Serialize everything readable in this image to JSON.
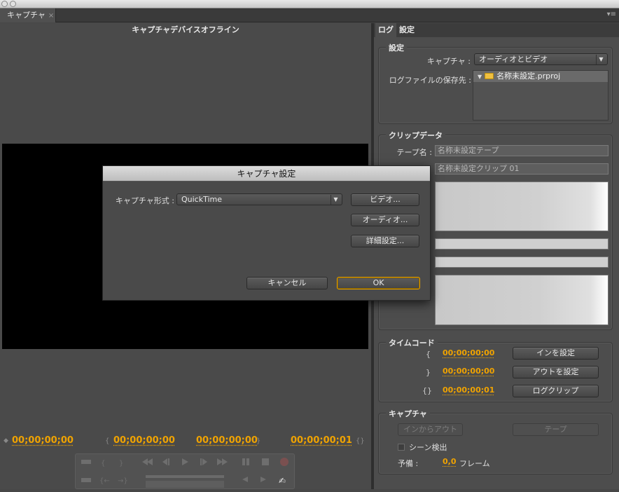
{
  "panel": {
    "tab_label": "キャプチャ",
    "close": "×",
    "menu_icon": "▾≡"
  },
  "monitor": {
    "status": "キャプチャデバイスオフライン",
    "timecodes": {
      "current": "00;00;00;00",
      "in": "00;00;00;00",
      "out": "00;00;00;00",
      "duration": "00;00;00;01"
    },
    "marks": {
      "in": "{",
      "out": "}",
      "dur": "{}"
    }
  },
  "right": {
    "tabs": [
      "ログ",
      "設定"
    ],
    "settings": {
      "title": "設定",
      "capture_label": "キャプチャ :",
      "capture_value": "オーディオとビデオ",
      "log_label": "ログファイルの保存先 :",
      "log_value": "名称未設定.prproj"
    },
    "clip": {
      "title": "クリップデータ",
      "tape_label": "テープ名 :",
      "tape_value": "名称未設定テープ",
      "clip_value": "名称未設定クリップ 01"
    },
    "timecode": {
      "title": "タイムコード",
      "in_mark": "{",
      "out_mark": "}",
      "dur_mark": "{}",
      "in_value": "00;00;00;00",
      "out_value": "00;00;00;00",
      "dur_value": "00;00;00;01",
      "set_in": "インを設定",
      "set_out": "アウトを設定",
      "log_clip": "ログクリップ"
    },
    "capture": {
      "title": "キャプチャ",
      "in_to_out": "インからアウト",
      "tape": "テープ",
      "scene_detect": "シーン検出",
      "handles_label": "予備 :",
      "handles_value": "0,0",
      "handles_unit": "フレーム"
    }
  },
  "dialog": {
    "title": "キャプチャ設定",
    "format_label": "キャプチャ形式 :",
    "format_value": "QuickTime",
    "video_btn": "ビデオ...",
    "audio_btn": "オーディオ...",
    "advanced_btn": "詳細設定...",
    "cancel": "キャンセル",
    "ok": "OK"
  },
  "colors": {
    "accent_timecode": "#f0a300",
    "ok_border": "#e8a200",
    "video_bg": "#000000"
  }
}
